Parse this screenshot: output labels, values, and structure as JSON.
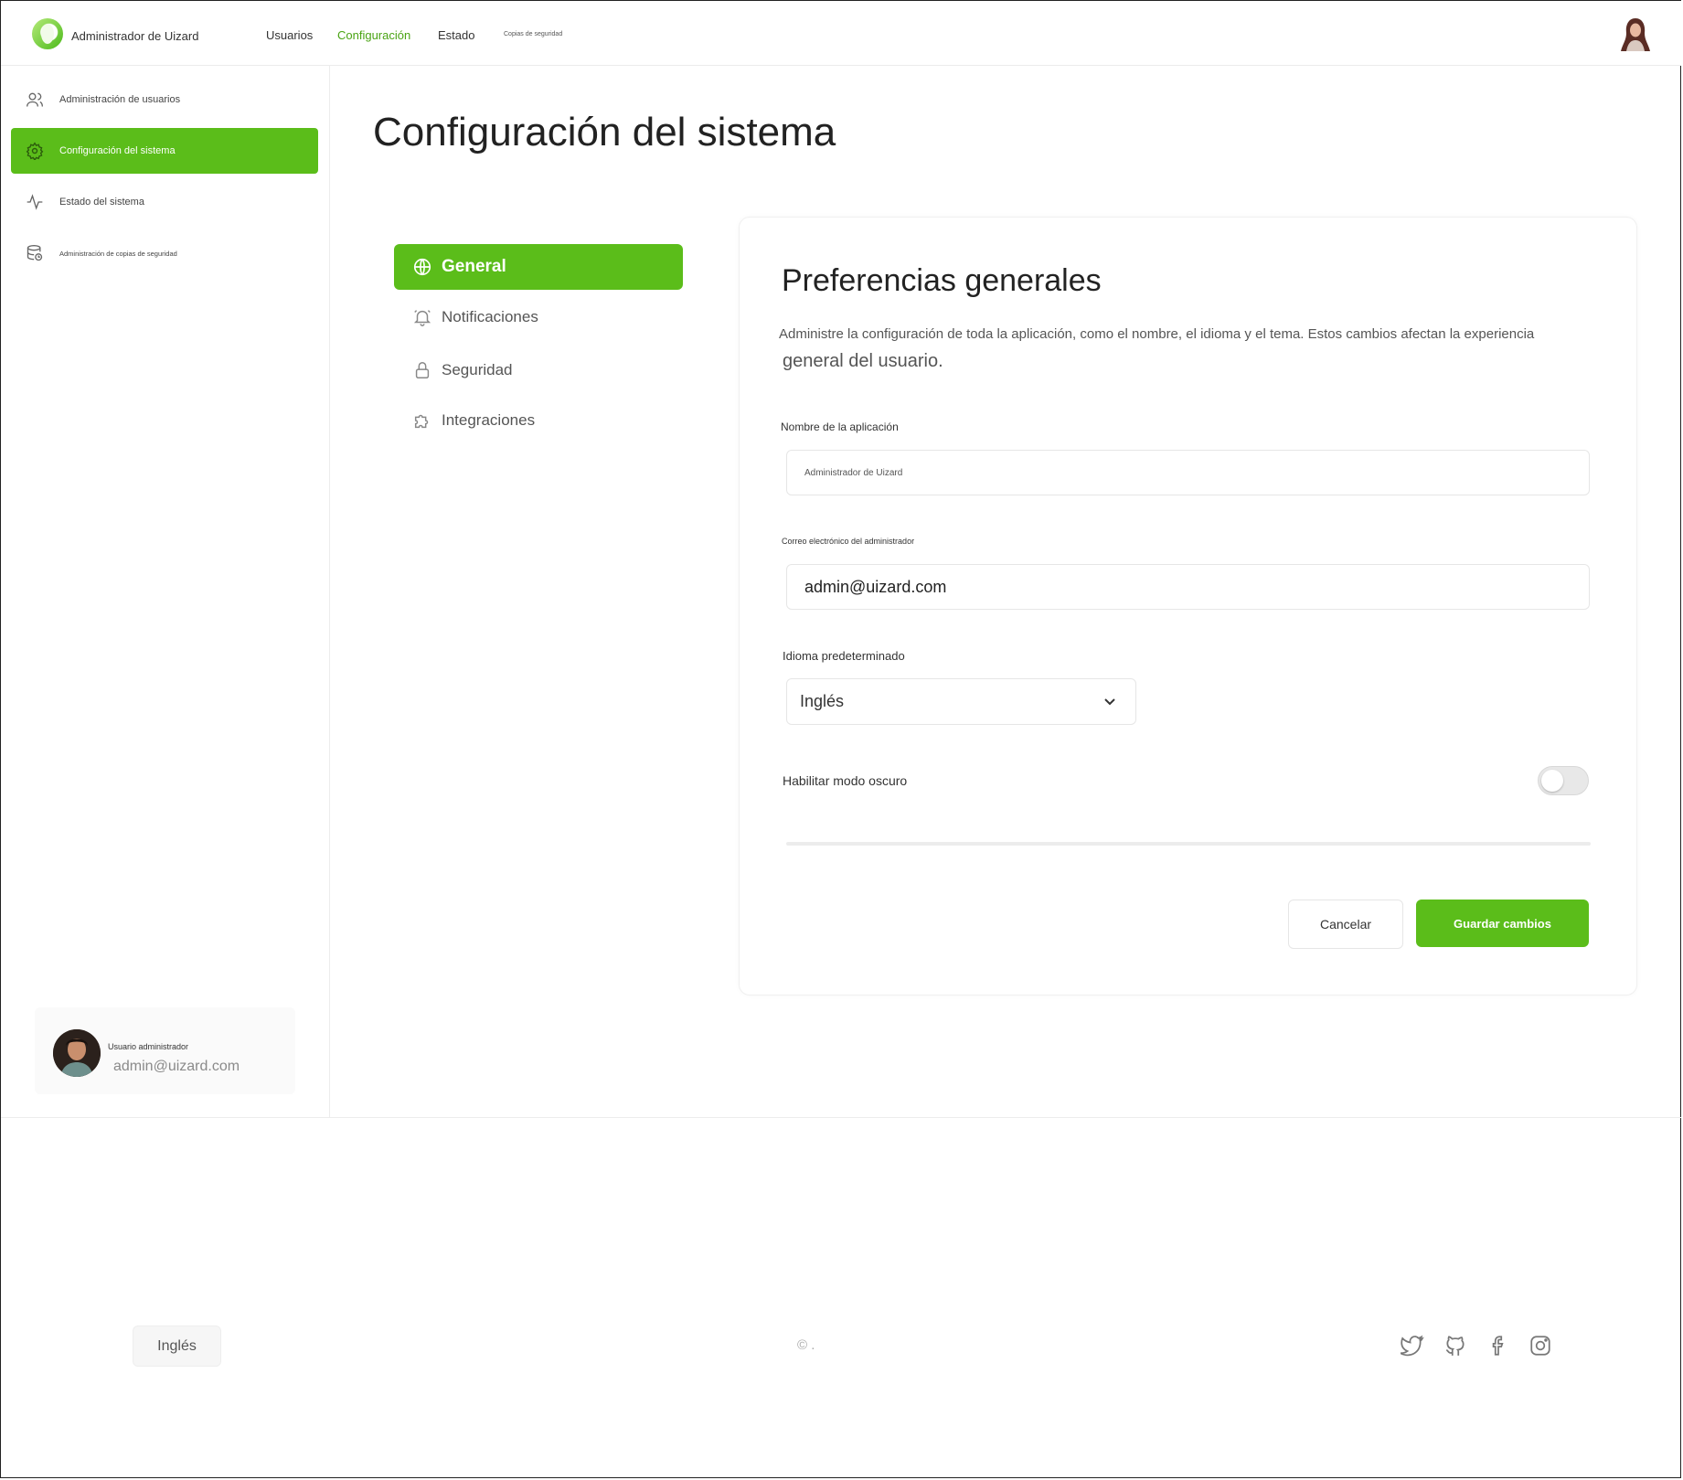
{
  "header": {
    "brand": "Administrador de Uizard",
    "nav": [
      {
        "label": "Usuarios",
        "active": false
      },
      {
        "label": "Configuración",
        "active": true
      },
      {
        "label": "Estado",
        "active": false
      },
      {
        "label": "Copias de seguridad",
        "active": false
      }
    ]
  },
  "sidebar": {
    "items": [
      {
        "label": "Administración de usuarios",
        "icon": "users-icon"
      },
      {
        "label": "Configuración del sistema",
        "icon": "gear-icon",
        "active": true
      },
      {
        "label": "Estado del sistema",
        "icon": "activity-icon"
      },
      {
        "label": "Administración de copias de seguridad",
        "icon": "database-icon"
      }
    ],
    "user": {
      "role": "Usuario administrador",
      "email": "admin@uizard.com"
    }
  },
  "main": {
    "title": "Configuración del sistema",
    "subnav": [
      {
        "label": "General",
        "icon": "globe-icon",
        "active": true
      },
      {
        "label": "Notificaciones",
        "icon": "bell-icon"
      },
      {
        "label": "Seguridad",
        "icon": "lock-icon"
      },
      {
        "label": "Integraciones",
        "icon": "puzzle-icon"
      }
    ],
    "card": {
      "title": "Preferencias generales",
      "desc_line1": "Administre la configuración de toda la aplicación, como el nombre, el idioma y el tema. Estos cambios afectan la experiencia",
      "desc_line2": "general del usuario.",
      "app_name_label": "Nombre de la aplicación",
      "app_name_value": "Administrador de Uizard",
      "email_label": "Correo electrónico del administrador",
      "email_value": "admin@uizard.com",
      "language_label": "Idioma predeterminado",
      "language_value": "Inglés",
      "dark_mode_label": "Habilitar modo oscuro",
      "dark_mode_enabled": false,
      "cancel_label": "Cancelar",
      "save_label": "Guardar cambios"
    }
  },
  "footer": {
    "language": "Inglés",
    "copyright": "© .",
    "social": [
      "twitter-icon",
      "github-icon",
      "facebook-icon",
      "instagram-icon"
    ]
  },
  "colors": {
    "accent": "#5bbd1a",
    "accent_text": "#4aa414"
  }
}
